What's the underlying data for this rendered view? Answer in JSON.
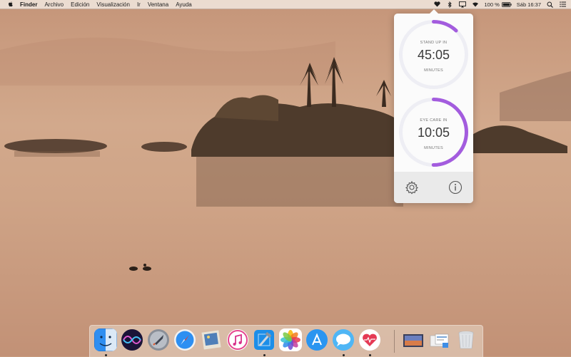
{
  "menubar": {
    "menus": [
      "Finder",
      "Archivo",
      "Edición",
      "Visualización",
      "Ir",
      "Ventana",
      "Ayuda"
    ],
    "battery": "100 %",
    "clock": "Sáb 16:37",
    "status_icons": [
      "heart-icon",
      "bluetooth-icon",
      "airplay-icon",
      "wifi-icon",
      "battery-icon",
      "search-icon",
      "list-icon"
    ]
  },
  "popover": {
    "timers": [
      {
        "title": "STAND UP IN",
        "time": "45:05",
        "unit": "MINUTES",
        "progress": 0.12
      },
      {
        "title": "EYE CARE IN",
        "time": "10:05",
        "unit": "MINUTES",
        "progress": 0.5
      }
    ],
    "footer": {
      "left_icon": "gear-icon",
      "right_icon": "info-icon"
    },
    "accent": "#a35cde"
  },
  "dock": {
    "apps": [
      "Finder",
      "Siri",
      "Launchpad",
      "Safari",
      "Preview",
      "iTunes",
      "Xcode",
      "Photos",
      "App Store",
      "Messages",
      "Health"
    ],
    "extras": [
      "Desktop",
      "Downloads",
      "Trash"
    ]
  }
}
